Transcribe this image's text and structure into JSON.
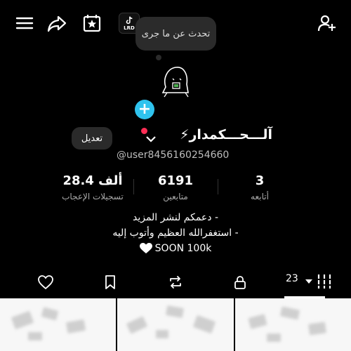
{
  "header": {
    "icons": [
      "menu-icon",
      "share-icon",
      "calendar-star-icon",
      "add-friend-icon"
    ],
    "mini_badge": "LRD"
  },
  "bubble": {
    "text": "تحدث عن ما جرى"
  },
  "profile": {
    "display_name": "آلـــحـــكمدار⚡",
    "username": "@user8456160254660",
    "edit_label": "تعديل"
  },
  "stats": {
    "likes": {
      "value": "28.4 ألف",
      "label": "تسجيلات الإعجاب"
    },
    "followers": {
      "value": "6191",
      "label": "متابعين"
    },
    "following": {
      "value": "3",
      "label": "أتابعه"
    }
  },
  "bio": {
    "line1": "- دعمكم لنشر المزيد",
    "line2": "- استغفرالله العظيم وأتوب إليه",
    "line3": "SOON 100k"
  },
  "tabs": {
    "icons": [
      "heart-outline-icon",
      "bookmark-icon",
      "repost-icon",
      "lock-icon",
      "grid-icon"
    ],
    "video_count": "23"
  },
  "colors": {
    "accent_blue": "#2fc3ee",
    "notification_red": "#ff2d55"
  }
}
